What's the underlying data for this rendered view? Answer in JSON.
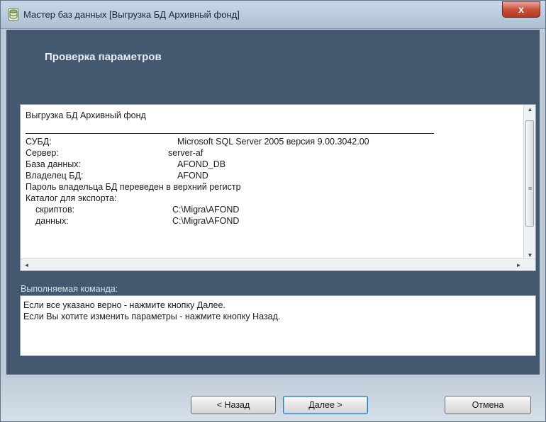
{
  "window": {
    "title": "Мастер баз данных [Выгрузка БД Архивный фонд]",
    "close_label": "x"
  },
  "header": {
    "title": "Проверка параметров"
  },
  "summary": {
    "heading": "Выгрузка БД Архивный фонд",
    "rows": [
      {
        "key": "СУБД:",
        "value": "Microsoft SQL Server 2005 версия 9.00.3042.00"
      },
      {
        "key": "Сервер:",
        "value": "server-af"
      },
      {
        "key": "База данных:",
        "value": "AFOND_DB"
      },
      {
        "key": "Владелец БД:",
        "value": "AFOND"
      }
    ],
    "note": "Пароль владельца БД переведен в верхний регистр",
    "export_catalog_label": "Каталог для экспорта:",
    "export_rows": [
      {
        "key": "скриптов:",
        "value": "C:\\Migra\\AFOND"
      },
      {
        "key": "данных:",
        "value": "C:\\Migra\\AFOND"
      }
    ]
  },
  "command": {
    "label": "Выполняемая команда:",
    "lines": [
      "Если все указано верно - нажмите кнопку Далее.",
      "Если Вы хотите изменить параметры - нажмите кнопку Назад."
    ]
  },
  "buttons": {
    "back": "< Назад",
    "next": "Далее >",
    "cancel": "Отмена"
  }
}
